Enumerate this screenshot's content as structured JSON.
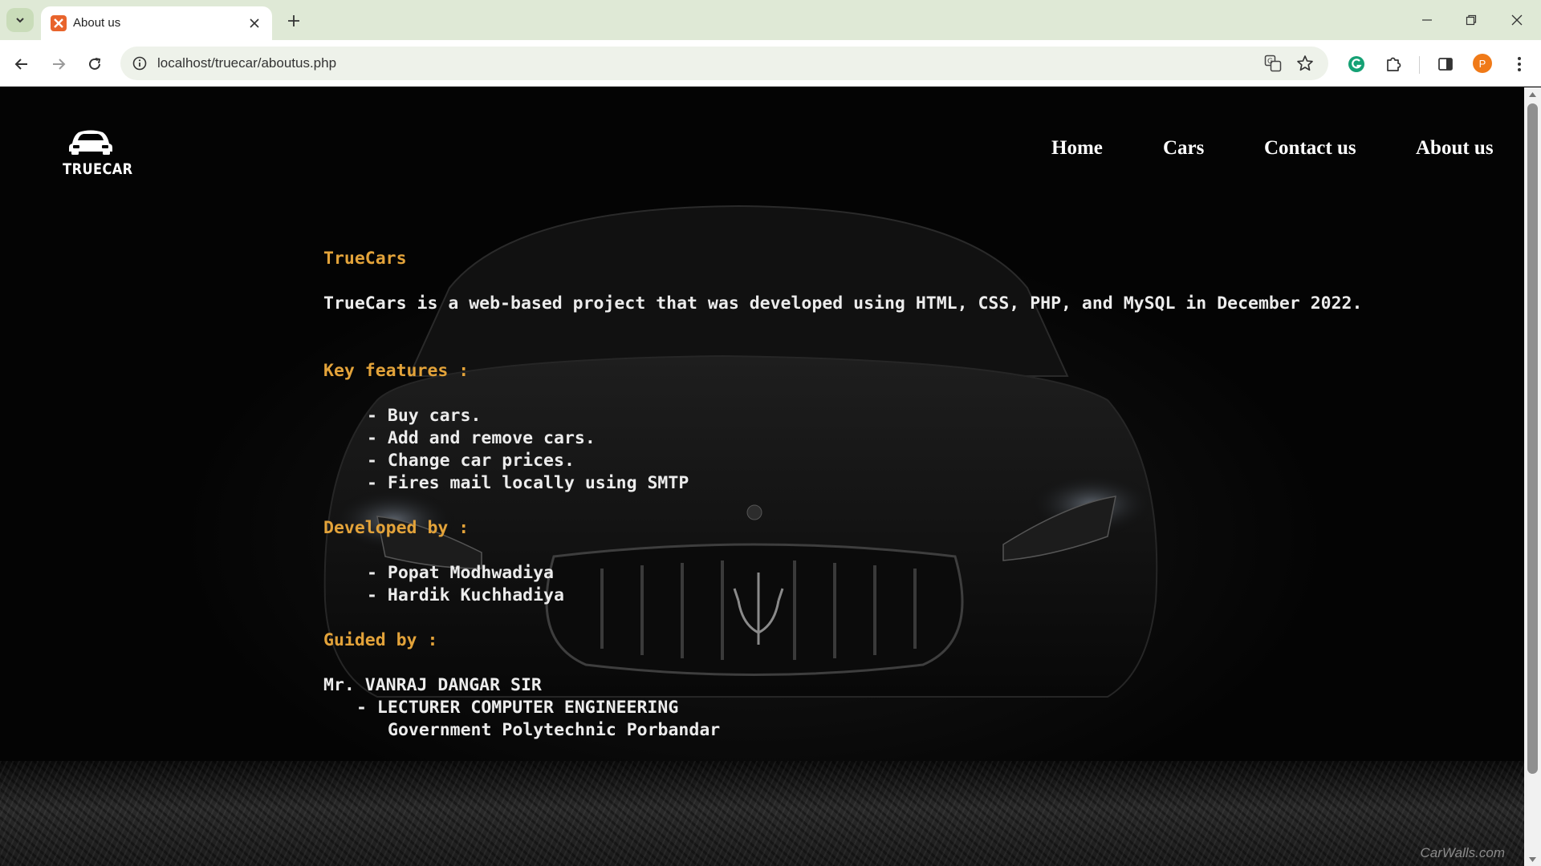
{
  "browser": {
    "tab_title": "About us",
    "url": "localhost/truecar/aboutus.php",
    "profile_initial": "P"
  },
  "site": {
    "logo_text": "TRUECAR",
    "nav": [
      {
        "label": "Home"
      },
      {
        "label": "Cars"
      },
      {
        "label": "Contact us"
      },
      {
        "label": "About us"
      }
    ]
  },
  "about": {
    "title": "TrueCars",
    "description": "TrueCars is a web-based project that was developed using HTML, CSS, PHP, and MySQL in December 2022.",
    "features_heading": "Key features :",
    "features": [
      "- Buy cars.",
      "- Add and remove cars.",
      "- Change car prices.",
      "- Fires mail locally using SMTP"
    ],
    "developers_heading": "Developed by :",
    "developers": [
      "- Popat Modhwadiya",
      "- Hardik Kuchhadiya"
    ],
    "guide_heading": "Guided by :",
    "guide_name": "Mr. VANRAJ DANGAR SIR",
    "guide_role": "- LECTURER COMPUTER ENGINEERING",
    "guide_institute": "Government Polytechnic Porbandar"
  },
  "watermark": "CarWalls.com",
  "colors": {
    "heading": "#e3a33a",
    "body_text": "#ececec",
    "background": "#000000",
    "chrome_tabbar": "#dfe9d6"
  }
}
